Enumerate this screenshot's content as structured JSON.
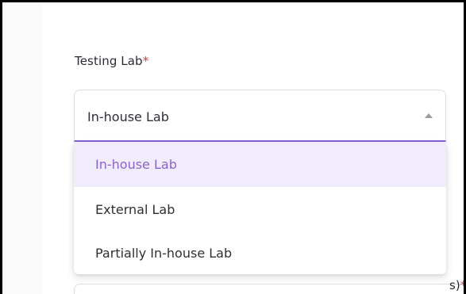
{
  "field": {
    "label": "Testing Lab",
    "required_mark": "*",
    "selected_value": "In-house Lab"
  },
  "dropdown": {
    "options": [
      {
        "label": "In-house Lab",
        "selected": true
      },
      {
        "label": "External Lab",
        "selected": false
      },
      {
        "label": "Partially In-house Lab",
        "selected": false
      }
    ]
  },
  "next_field": {
    "label_fragment": "s)",
    "required_mark": "*"
  },
  "colors": {
    "accent": "#8a63d2",
    "required": "#e23b3b",
    "selected_bg": "#f1ecfb"
  },
  "icons": {
    "caret": "caret-up-icon"
  }
}
